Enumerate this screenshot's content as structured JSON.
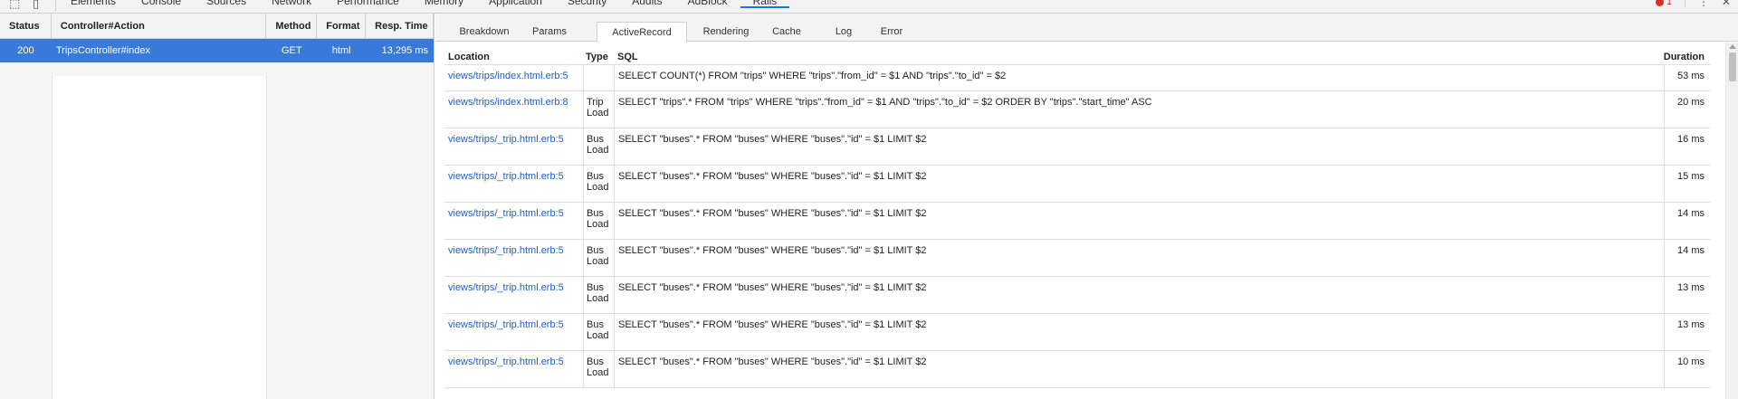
{
  "devtools": {
    "tabs": [
      "Elements",
      "Console",
      "Sources",
      "Network",
      "Performance",
      "Memory",
      "Application",
      "Security",
      "Audits",
      "AdBlock",
      "Rails"
    ],
    "active_tab": "Rails",
    "error_count": "1",
    "more_glyph": "⋮",
    "close_glyph": "✕",
    "inspect_glyph": "⬚",
    "device_glyph": "▯"
  },
  "requests": {
    "headers": {
      "status": "Status",
      "action": "Controller#Action",
      "method": "Method",
      "format": "Format",
      "resp_time": "Resp. Time"
    },
    "rows": [
      {
        "status": "200",
        "action": "TripsController#index",
        "method": "GET",
        "format": "html",
        "resp_time": "13,295 ms"
      }
    ]
  },
  "subtabs": {
    "items": [
      "Breakdown",
      "Params",
      "ActiveRecord",
      "Rendering",
      "Cache",
      "Log",
      "Error"
    ],
    "active": "ActiveRecord"
  },
  "activerecord": {
    "headers": {
      "location": "Location",
      "type": "Type",
      "sql": "SQL",
      "duration": "Duration"
    },
    "rows": [
      {
        "location": "views/trips/index.html.erb:5",
        "type": "",
        "sql": "SELECT COUNT(*) FROM \"trips\" WHERE \"trips\".\"from_id\" = $1 AND \"trips\".\"to_id\" = $2",
        "duration": "53 ms"
      },
      {
        "location": "views/trips/index.html.erb:8",
        "type": "Trip Load",
        "sql": "SELECT \"trips\".* FROM \"trips\" WHERE \"trips\".\"from_id\" = $1 AND \"trips\".\"to_id\" = $2 ORDER BY \"trips\".\"start_time\" ASC",
        "duration": "20 ms"
      },
      {
        "location": "views/trips/_trip.html.erb:5",
        "type": "Bus Load",
        "sql": "SELECT \"buses\".* FROM \"buses\" WHERE \"buses\".\"id\" = $1 LIMIT $2",
        "duration": "16 ms"
      },
      {
        "location": "views/trips/_trip.html.erb:5",
        "type": "Bus Load",
        "sql": "SELECT \"buses\".* FROM \"buses\" WHERE \"buses\".\"id\" = $1 LIMIT $2",
        "duration": "15 ms"
      },
      {
        "location": "views/trips/_trip.html.erb:5",
        "type": "Bus Load",
        "sql": "SELECT \"buses\".* FROM \"buses\" WHERE \"buses\".\"id\" = $1 LIMIT $2",
        "duration": "14 ms"
      },
      {
        "location": "views/trips/_trip.html.erb:5",
        "type": "Bus Load",
        "sql": "SELECT \"buses\".* FROM \"buses\" WHERE \"buses\".\"id\" = $1 LIMIT $2",
        "duration": "14 ms"
      },
      {
        "location": "views/trips/_trip.html.erb:5",
        "type": "Bus Load",
        "sql": "SELECT \"buses\".* FROM \"buses\" WHERE \"buses\".\"id\" = $1 LIMIT $2",
        "duration": "13 ms"
      },
      {
        "location": "views/trips/_trip.html.erb:5",
        "type": "Bus Load",
        "sql": "SELECT \"buses\".* FROM \"buses\" WHERE \"buses\".\"id\" = $1 LIMIT $2",
        "duration": "13 ms"
      },
      {
        "location": "views/trips/_trip.html.erb:5",
        "type": "Bus Load",
        "sql": "SELECT \"buses\".* FROM \"buses\" WHERE \"buses\".\"id\" = $1 LIMIT $2",
        "duration": "10 ms"
      }
    ]
  },
  "colors": {
    "selected_row": "#3879d9",
    "link": "#1a5fd0",
    "error": "#d93025",
    "active_tab_underline": "#1a73e8"
  }
}
